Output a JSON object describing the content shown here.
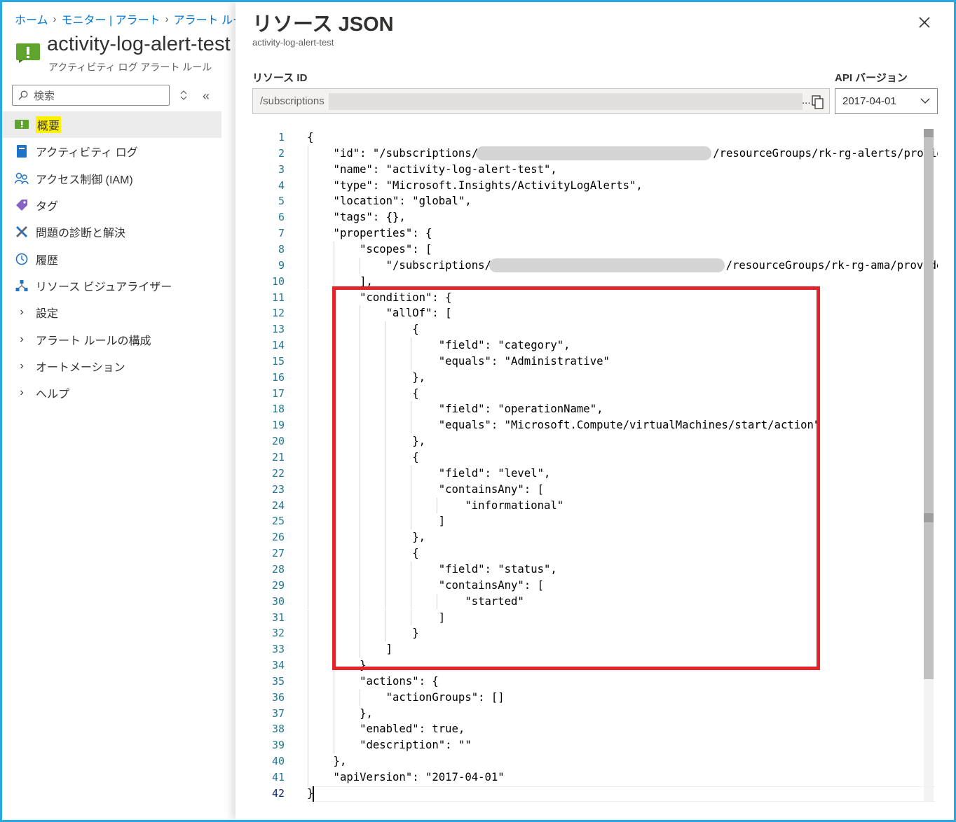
{
  "breadcrumb": [
    "ホーム",
    "モニター | アラート",
    "アラート ルール"
  ],
  "resource": {
    "name": "activity-log-alert-test",
    "type": "アクティビティ ログ アラート ルール"
  },
  "search": {
    "placeholder": "検索"
  },
  "nav": [
    {
      "label": "概要",
      "icon": "alert-rule-icon",
      "active": true,
      "highlighted": true
    },
    {
      "label": "アクティビティ ログ",
      "icon": "activity-log-icon"
    },
    {
      "label": "アクセス制御 (IAM)",
      "icon": "iam-users-icon"
    },
    {
      "label": "タグ",
      "icon": "tag-icon"
    },
    {
      "label": "問題の診断と解決",
      "icon": "wrench-icon"
    },
    {
      "label": "履歴",
      "icon": "clock-icon"
    },
    {
      "label": "リソース ビジュアライザー",
      "icon": "visualizer-icon"
    },
    {
      "label": "設定",
      "group": true
    },
    {
      "label": "アラート ルールの構成",
      "group": true
    },
    {
      "label": "オートメーション",
      "group": true
    },
    {
      "label": "ヘルプ",
      "group": true
    }
  ],
  "panel": {
    "title": "リソース JSON",
    "subtitle": "activity-log-alert-test",
    "resource_id_label": "リソース ID",
    "resource_id_value": "/subscriptions",
    "resource_id_ellipsis": "...",
    "api_label": "API バージョン",
    "api_value": "2017-04-01"
  },
  "code_lines": [
    "{",
    "    \"id\": \"/subscriptions/",
    "    \"name\": \"activity-log-alert-test\",",
    "    \"type\": \"Microsoft.Insights/ActivityLogAlerts\",",
    "    \"location\": \"global\",",
    "    \"tags\": {},",
    "    \"properties\": {",
    "        \"scopes\": [",
    "            \"/subscriptions/",
    "        ],",
    "        \"condition\": {",
    "            \"allOf\": [",
    "                {",
    "                    \"field\": \"category\",",
    "                    \"equals\": \"Administrative\"",
    "                },",
    "                {",
    "                    \"field\": \"operationName\",",
    "                    \"equals\": \"Microsoft.Compute/virtualMachines/start/action\"",
    "                },",
    "                {",
    "                    \"field\": \"level\",",
    "                    \"containsAny\": [",
    "                        \"informational\"",
    "                    ]",
    "                },",
    "                {",
    "                    \"field\": \"status\",",
    "                    \"containsAny\": [",
    "                        \"started\"",
    "                    ]",
    "                }",
    "            ]",
    "        },",
    "        \"actions\": {",
    "            \"actionGroups\": []",
    "        },",
    "        \"enabled\": true,",
    "        \"description\": \"\"",
    "    },",
    "    \"apiVersion\": \"2017-04-01\"",
    "}"
  ],
  "code_tails": {
    "2": "/resourceGroups/rk-rg-alerts/provid",
    "9": "/resourceGroups/rk-rg-ama/provide"
  },
  "current_line": 42,
  "colors": {
    "accent": "#0078d4",
    "highlight": "#fff200",
    "annotation_box": "#e3242b",
    "line_number": "#237893"
  }
}
